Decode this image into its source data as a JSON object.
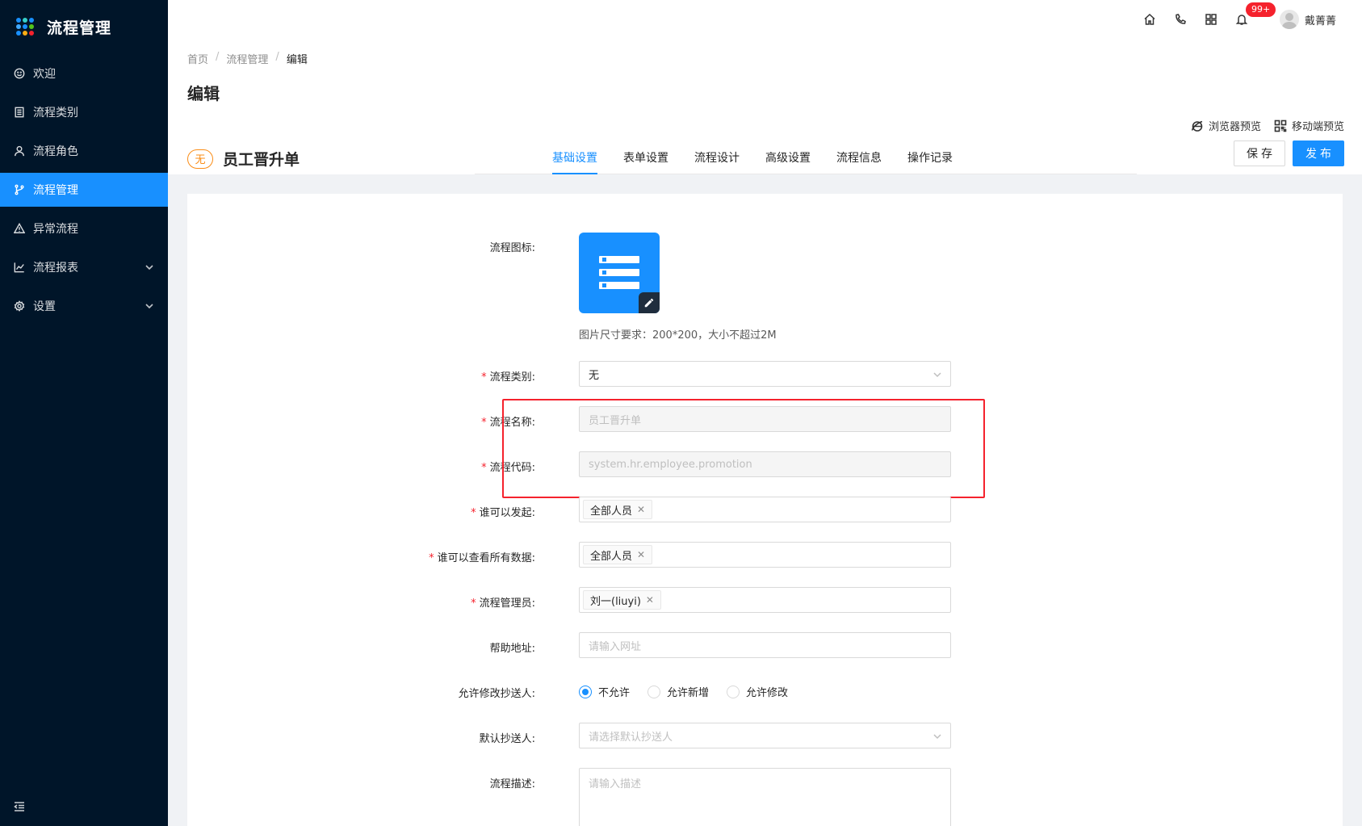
{
  "app": {
    "title": "流程管理"
  },
  "sidebar": {
    "items": [
      {
        "label": "欢迎",
        "icon": "smile-icon"
      },
      {
        "label": "流程类别",
        "icon": "list-icon"
      },
      {
        "label": "流程角色",
        "icon": "user-icon"
      },
      {
        "label": "流程管理",
        "icon": "branch-icon",
        "active": true
      },
      {
        "label": "异常流程",
        "icon": "warning-icon"
      },
      {
        "label": "流程报表",
        "icon": "chart-icon",
        "expandable": true
      },
      {
        "label": "设置",
        "icon": "gear-icon",
        "expandable": true
      }
    ]
  },
  "header": {
    "notification_badge": "99+",
    "username": "戴菁菁"
  },
  "breadcrumb": {
    "home": "首页",
    "section": "流程管理",
    "current": "编辑"
  },
  "page": {
    "title": "编辑"
  },
  "preview": {
    "browser": "浏览器预览",
    "mobile": "移动端预览"
  },
  "flow": {
    "badge": "无",
    "name": "员工晋升单"
  },
  "tabs": [
    "基础设置",
    "表单设置",
    "流程设计",
    "高级设置",
    "流程信息",
    "操作记录"
  ],
  "actions": {
    "save": "保存",
    "publish": "发布"
  },
  "form": {
    "icon_label": "流程图标:",
    "icon_hint": "图片尺寸要求：200*200，大小不超过2M",
    "category_label": "流程类别:",
    "category_value": "无",
    "name_label": "流程名称:",
    "name_value": "员工晋升单",
    "code_label": "流程代码:",
    "code_value": "system.hr.employee.promotion",
    "initiator_label": "谁可以发起:",
    "initiator_tag": "全部人员",
    "viewer_label": "谁可以查看所有数据:",
    "viewer_tag": "全部人员",
    "admin_label": "流程管理员:",
    "admin_tag": "刘一(liuyi)",
    "help_label": "帮助地址:",
    "help_placeholder": "请输入网址",
    "cc_modify_label": "允许修改抄送人:",
    "cc_options": [
      "不允许",
      "允许新增",
      "允许修改"
    ],
    "cc_selected": "不允许",
    "default_cc_label": "默认抄送人:",
    "default_cc_placeholder": "请选择默认抄送人",
    "desc_label": "流程描述:",
    "desc_placeholder": "请输入描述"
  },
  "colors": {
    "primary": "#1890ff",
    "sidebar": "#001529",
    "required": "#f5222d",
    "highlight": "#f5222d"
  }
}
